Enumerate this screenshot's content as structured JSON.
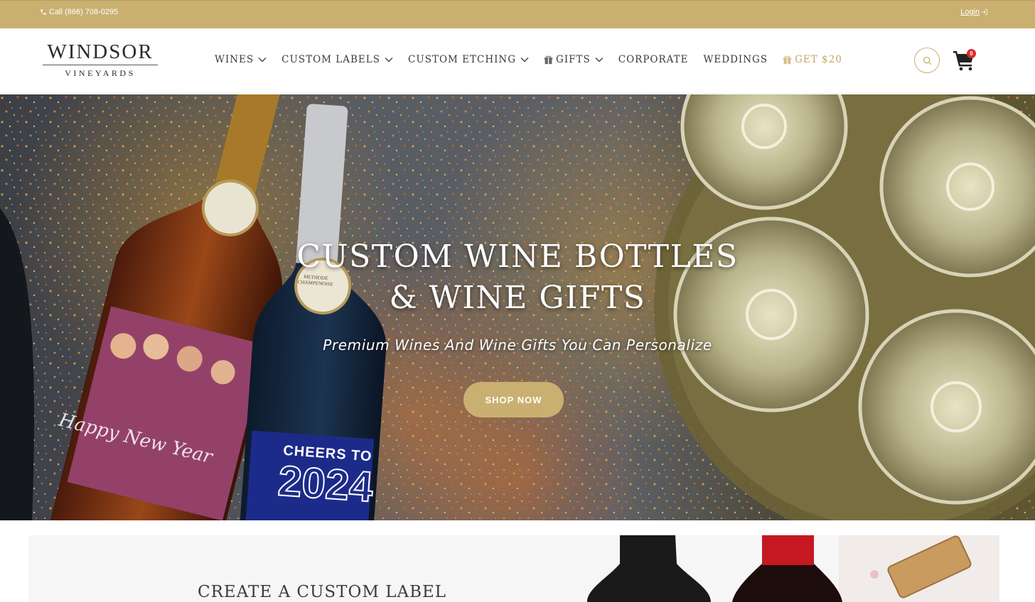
{
  "topbar": {
    "phone_label": "Call (866) 708-0295",
    "login_label": "Login"
  },
  "header": {
    "logo_main": "WINDSOR",
    "logo_sub": "VINEYARDS",
    "nav": [
      {
        "label": "WINES",
        "has_dropdown": true
      },
      {
        "label": "CUSTOM LABELS",
        "has_dropdown": true
      },
      {
        "label": "CUSTOM ETCHING",
        "has_dropdown": true
      },
      {
        "label": "GIFTS",
        "has_dropdown": true,
        "icon": "gift-icon"
      },
      {
        "label": "CORPORATE",
        "has_dropdown": false
      },
      {
        "label": "WEDDINGS",
        "has_dropdown": false
      },
      {
        "label": "GET $20",
        "has_dropdown": false,
        "icon": "gift-icon"
      }
    ],
    "cart_count": "0"
  },
  "hero": {
    "title_line1": "CUSTOM WINE BOTTLES",
    "title_line2": "& WINE GIFTS",
    "subtitle": "Premium Wines And Wine Gifts You Can Personalize",
    "cta_label": "SHOP NOW",
    "bottle_label_1": "Happy New Year",
    "bottle_label_2_line1": "CHEERS TO",
    "bottle_label_2_line2": "2024",
    "seal_text": "METHODE CHAMPENOISE"
  },
  "promo": {
    "title": "CREATE A CUSTOM LABEL"
  },
  "colors": {
    "brand_gold": "#c9b071",
    "accent_gold_text": "#c2a665",
    "cart_badge": "#d92b2b"
  }
}
